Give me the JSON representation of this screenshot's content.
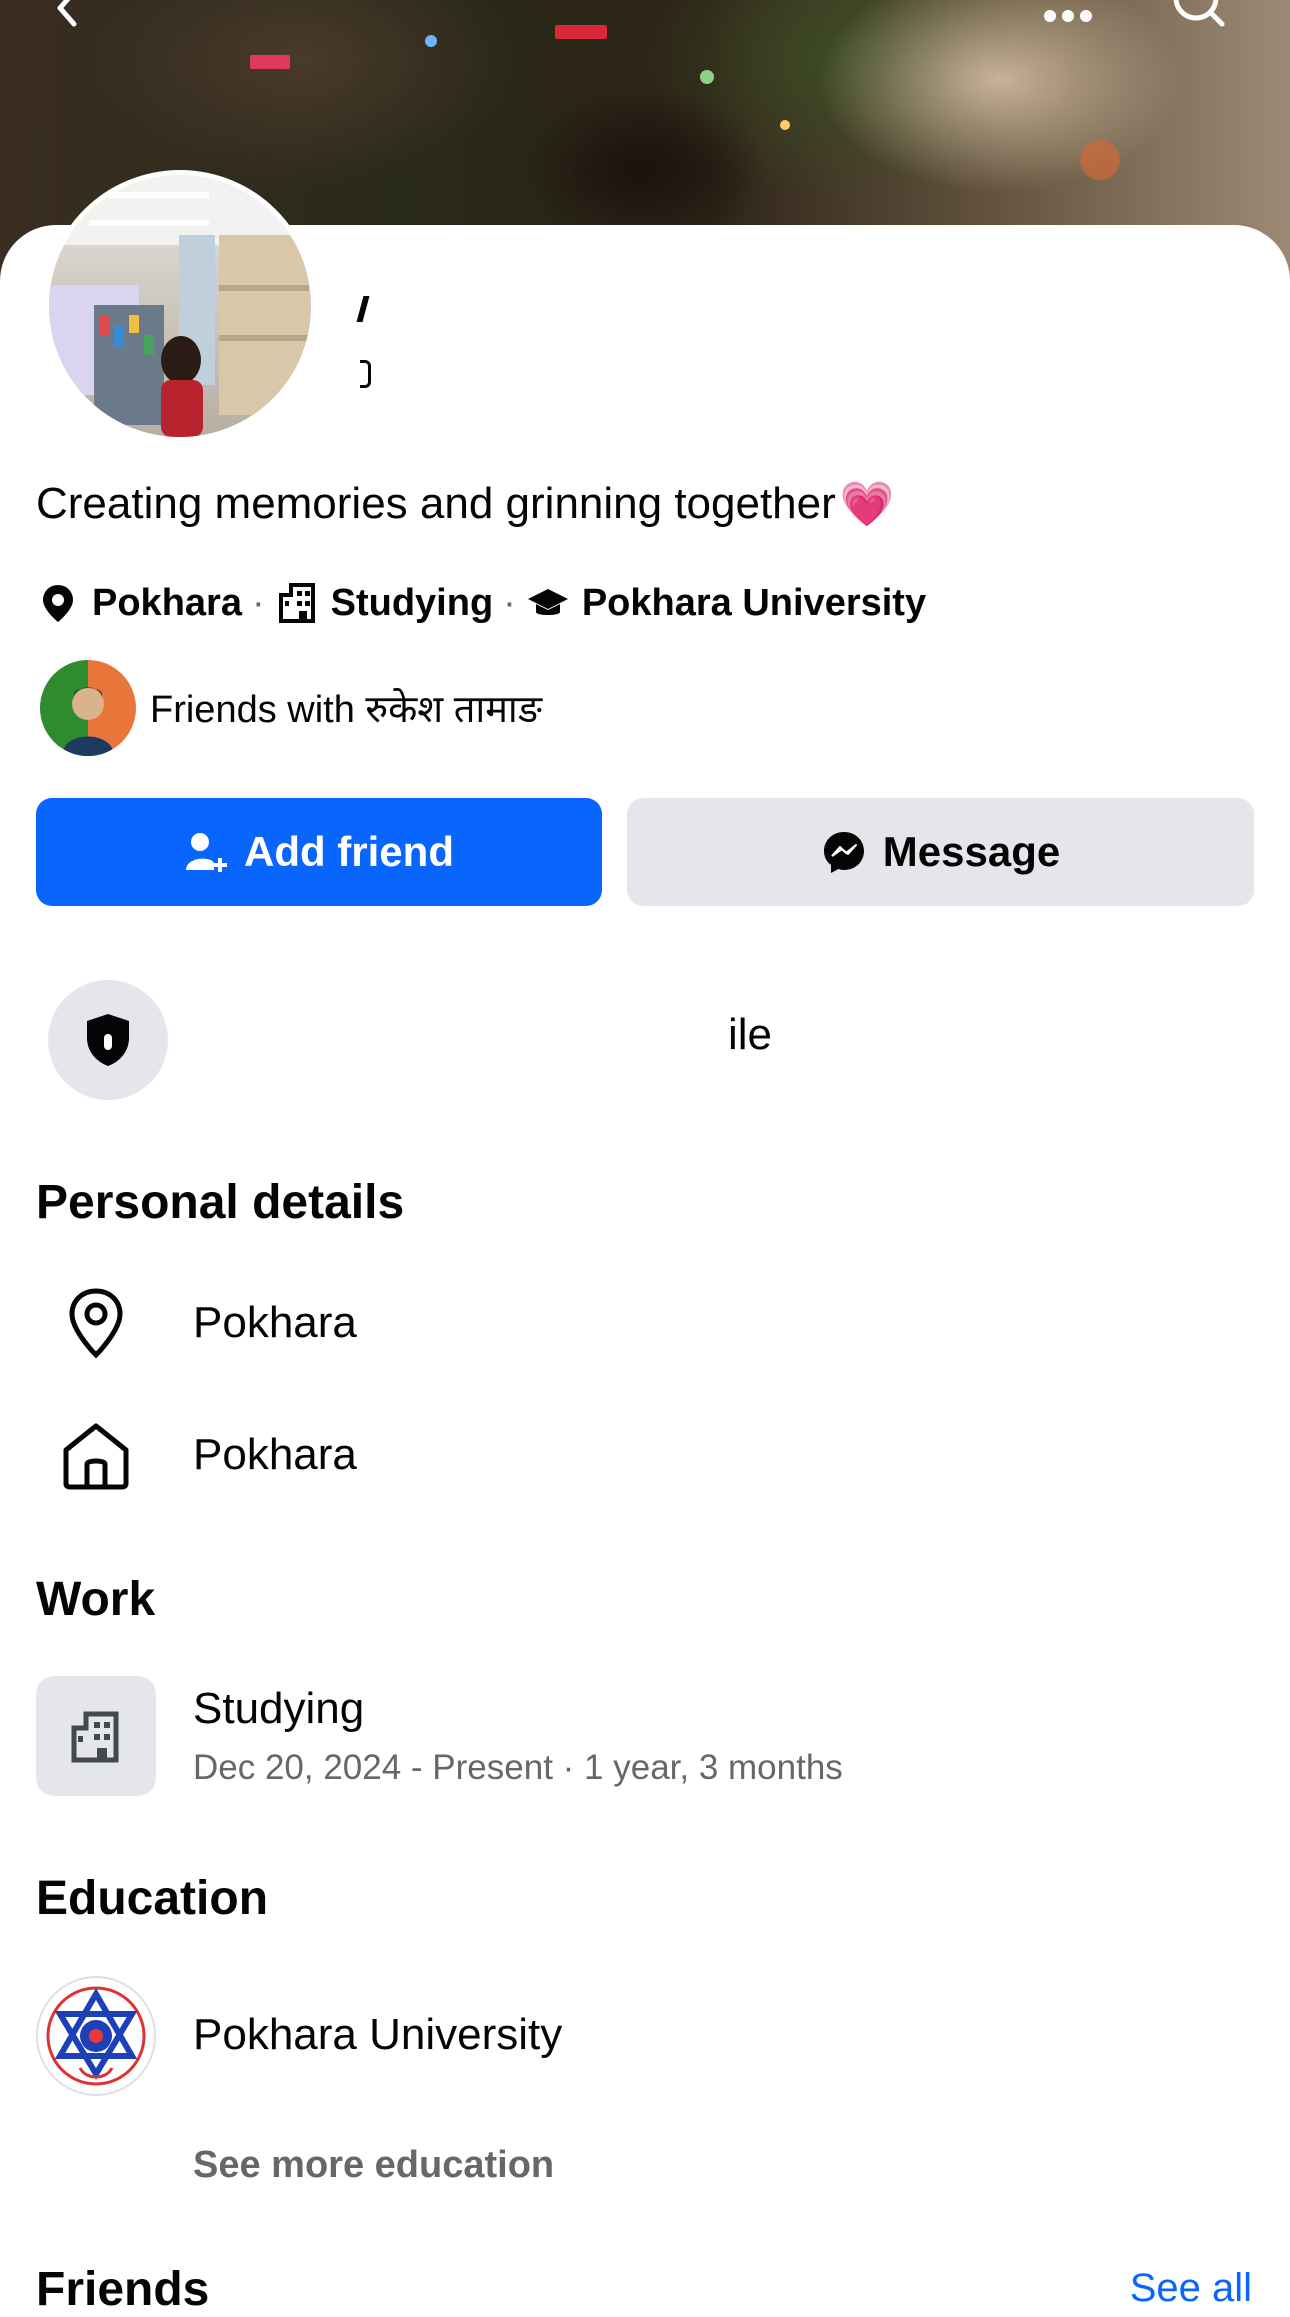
{
  "profile": {
    "bio": "Creating memories and grinning together",
    "bio_emoji": "💗",
    "meta": {
      "location": "Pokhara",
      "work": "Studying",
      "school": "Pokhara University",
      "separator": "·"
    },
    "mutual_friends_text": "Friends with रुकेश तामाङ"
  },
  "actions": {
    "add_friend_label": "Add friend",
    "message_label": "Message"
  },
  "lock_banner": {
    "partial_text": "ile"
  },
  "personal_details": {
    "title": "Personal details",
    "current_city": "Pokhara",
    "hometown": "Pokhara"
  },
  "work": {
    "title": "Work",
    "entry_title": "Studying",
    "entry_subtitle": "Dec 20, 2024 - Present · 1 year, 3 months"
  },
  "education": {
    "title": "Education",
    "entry_title": "Pokhara University",
    "see_more": "See more education"
  },
  "friends": {
    "title": "Friends",
    "see_all": "See all"
  },
  "colors": {
    "primary_blue": "#0866ff",
    "secondary_gray": "#e4e6eb",
    "muted_text": "#65676b",
    "text": "#050505"
  },
  "icons": {
    "back": "chevron-left-icon",
    "more": "more-dots-icon",
    "search": "search-icon",
    "location": "location-pin-icon",
    "work": "building-icon",
    "school": "graduation-cap-icon",
    "add_friend": "add-person-icon",
    "message": "messenger-icon",
    "lock": "shield-lock-icon",
    "home": "home-icon"
  }
}
